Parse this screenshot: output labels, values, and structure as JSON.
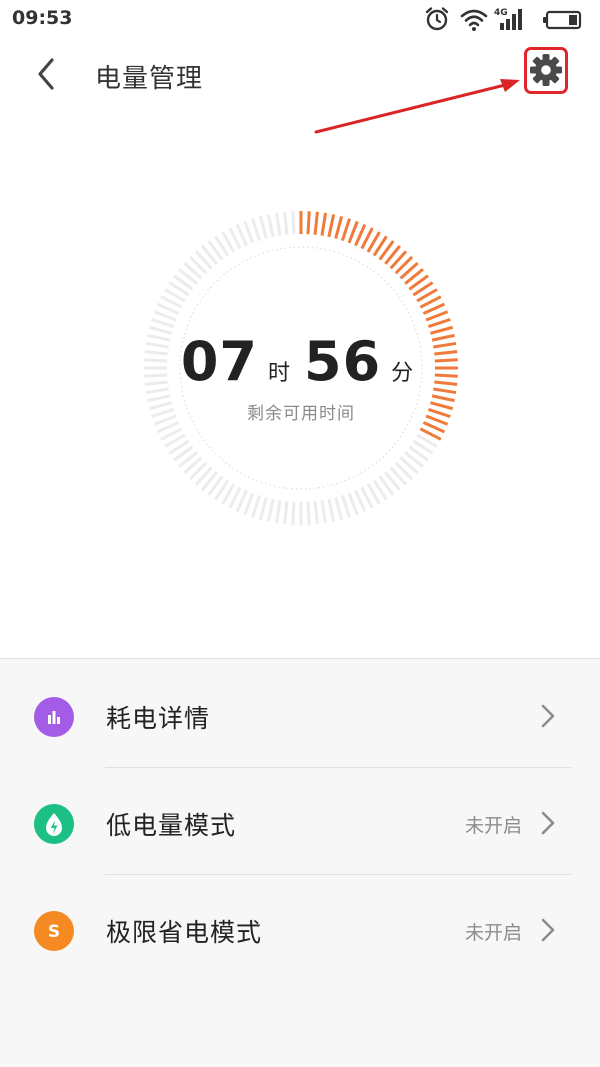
{
  "status_bar": {
    "time": "09:53",
    "network_label": "4G",
    "icons": [
      "alarm-icon",
      "wifi-icon",
      "signal-icon",
      "battery-icon"
    ]
  },
  "header": {
    "title": "电量管理",
    "back_icon": "chevron-left-icon",
    "settings_icon": "gear-icon"
  },
  "battery": {
    "hours": "07",
    "hours_unit": "时",
    "minutes": "56",
    "minutes_unit": "分",
    "caption": "剩余可用时间",
    "remaining_fraction": 0.33,
    "accent_color": "#f07a3a",
    "track_color": "#ececec"
  },
  "list": {
    "items": [
      {
        "label": "耗电详情",
        "status": "",
        "icon": "bar-chart-icon",
        "icon_color": "#a35ce6"
      },
      {
        "label": "低电量模式",
        "status": "未开启",
        "icon": "leaf-bolt-icon",
        "icon_color": "#1cbf84"
      },
      {
        "label": "极限省电模式",
        "status": "未开启",
        "icon": "s-letter-icon",
        "icon_letter": "S",
        "icon_color": "#f58a22"
      }
    ]
  }
}
